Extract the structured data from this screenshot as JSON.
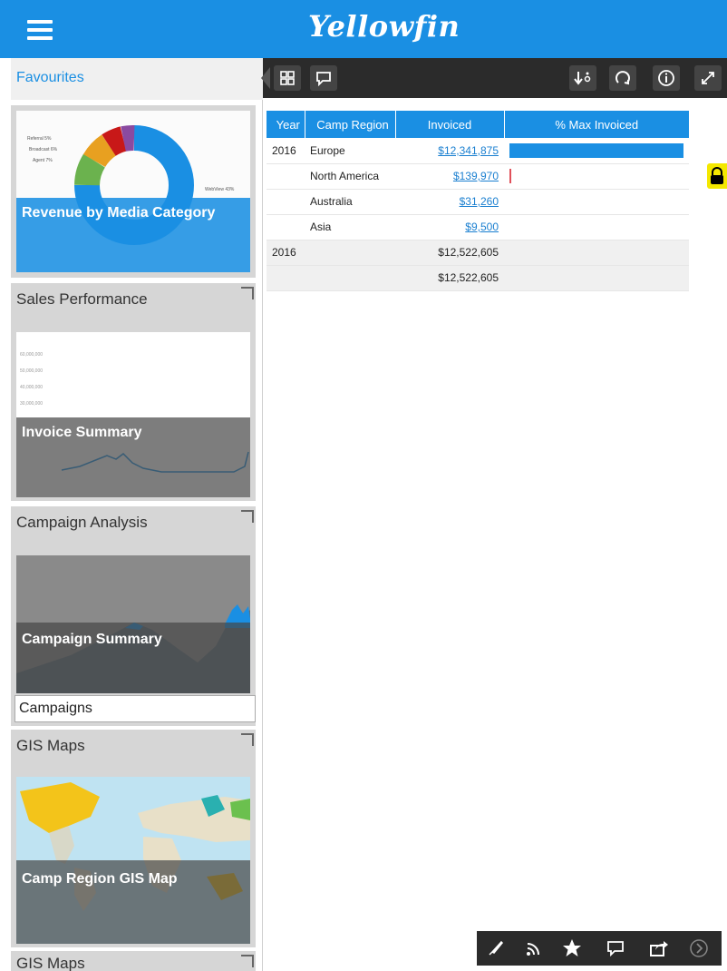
{
  "app": {
    "logo": "Yellowfin"
  },
  "sidebar": {
    "favourites_label": "Favourites",
    "cards": [
      {
        "title": "",
        "thumb_label": "Revenue by Media Category"
      },
      {
        "title": "Sales Performance",
        "thumb_label": "Invoice Summary"
      },
      {
        "title": "Campaign Analysis",
        "thumb_label": "Campaign Summary",
        "sub_label": "Campaigns"
      },
      {
        "title": "GIS Maps",
        "thumb_label": "Camp Region GIS Map"
      },
      {
        "title": "GIS Maps"
      }
    ],
    "donut_labels": [
      "Referral 5%",
      "Broadcast 6%",
      "Agent 7%",
      "WebView 43%"
    ],
    "invoice_yticks": [
      "60,000,000",
      "50,000,000",
      "40,000,000",
      "30,000,000"
    ]
  },
  "toolbar": {
    "icons": [
      "grid-icon",
      "comment-icon",
      "sort-download-icon",
      "refresh-icon",
      "info-icon",
      "expand-icon"
    ]
  },
  "table": {
    "headers": [
      "Year",
      "Camp Region",
      "Invoiced",
      "% Max Invoiced"
    ],
    "rows": [
      {
        "year": "2016",
        "region": "Europe",
        "invoiced": "$12,341,875",
        "pct": 1.0,
        "bar_color": "#1a8fe3"
      },
      {
        "year": "",
        "region": "North America",
        "invoiced": "$139,970",
        "pct": 0.011,
        "bar_color": "#e0505a"
      },
      {
        "year": "",
        "region": "Australia",
        "invoiced": "$31,260",
        "pct": 0.0
      },
      {
        "year": "",
        "region": "Asia",
        "invoiced": "$9,500",
        "pct": 0.0
      }
    ],
    "subtotal": {
      "year": "2016",
      "invoiced": "$12,522,605"
    },
    "grand_total": {
      "invoiced": "$12,522,605"
    }
  },
  "bottombar": {
    "icons": [
      "brush-icon",
      "feed-icon",
      "star-icon",
      "comment-icon",
      "share-icon",
      "next-icon"
    ]
  },
  "colors": {
    "brand": "#1a8fe3",
    "toolbar": "#2b2b2b",
    "lock": "#f4e800"
  }
}
